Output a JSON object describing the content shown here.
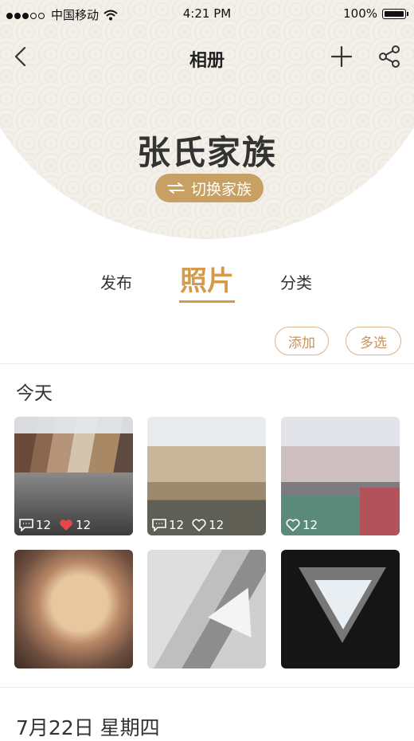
{
  "status_bar": {
    "carrier": "中国移动",
    "time": "4:21 PM",
    "battery": "100%"
  },
  "navbar": {
    "title": "相册"
  },
  "family": {
    "name": "张氏家族",
    "switch_label": "切换家族"
  },
  "tabs": [
    {
      "label": "发布"
    },
    {
      "label": "照片"
    },
    {
      "label": "分类"
    }
  ],
  "actions": {
    "add": "添加",
    "multi_select": "多选"
  },
  "sections": [
    {
      "title": "今天",
      "photos": [
        {
          "comments": "12",
          "likes": "12",
          "liked": true
        },
        {
          "comments": "12",
          "likes": "12",
          "liked": false
        },
        {
          "comments": "",
          "likes": "12",
          "liked": false
        },
        {},
        {},
        {}
      ]
    },
    {
      "title": "7月22日 星期四"
    }
  ],
  "colors": {
    "accent": "#d49a4c",
    "switch_bg": "#c8a063",
    "like_active": "#e8474a"
  }
}
